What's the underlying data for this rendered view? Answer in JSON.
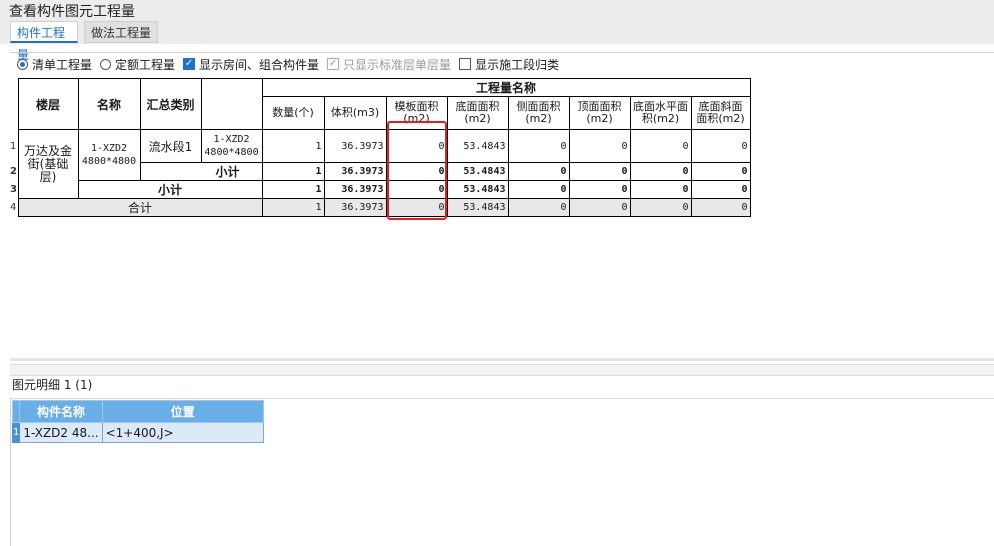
{
  "window": {
    "title": "查看构件图元工程量"
  },
  "tabs": [
    {
      "label": "构件工程量",
      "active": true
    },
    {
      "label": "做法工程量",
      "active": false
    }
  ],
  "options": {
    "radio_bill": "清单工程量",
    "radio_quota": "定额工程量",
    "check_rooms": "显示房间、组合构件量",
    "check_standard": "只显示标准层单层量",
    "check_segment": "显示施工段归类"
  },
  "grid": {
    "headers": {
      "floor": "楼层",
      "name": "名称",
      "summary": "汇总类别",
      "qty_group": "工程量名称",
      "count": "数量(个)",
      "volume": "体积(m3)",
      "formwork": "模板面积(m2)",
      "bottom": "底面面积(m2)",
      "side": "侧面面积(m2)",
      "top": "顶面面积(m2)",
      "bottom_h": "底面水平面积(m2)",
      "bottom_s": "底面斜面面积(m2)"
    },
    "row_numbers": [
      "1",
      "2",
      "3",
      "4"
    ],
    "floor_value": "万达及金街(基础层)",
    "name_value": "1-XZD2 4800*4800",
    "summary_value": "流水段1",
    "extra_value": "1-XZD2 4800*4800",
    "subtotal_label": "小计",
    "total_label": "合计",
    "row1": [
      "1",
      "36.3973",
      "0",
      "53.4843",
      "0",
      "0",
      "0",
      "0"
    ],
    "row2": [
      "1",
      "36.3973",
      "0",
      "53.4843",
      "0",
      "0",
      "0",
      "0"
    ],
    "row3": [
      "1",
      "36.3973",
      "0",
      "53.4843",
      "0",
      "0",
      "0",
      "0"
    ],
    "row4": [
      "1",
      "36.3973",
      "0",
      "53.4843",
      "0",
      "0",
      "0",
      "0"
    ]
  },
  "detail": {
    "title": "图元明细  1 (1)",
    "col_name": "构件名称",
    "col_position": "位置",
    "row_number": "1",
    "row_name": "1-XZD2 48...",
    "row_position": "<1+400,J>"
  }
}
